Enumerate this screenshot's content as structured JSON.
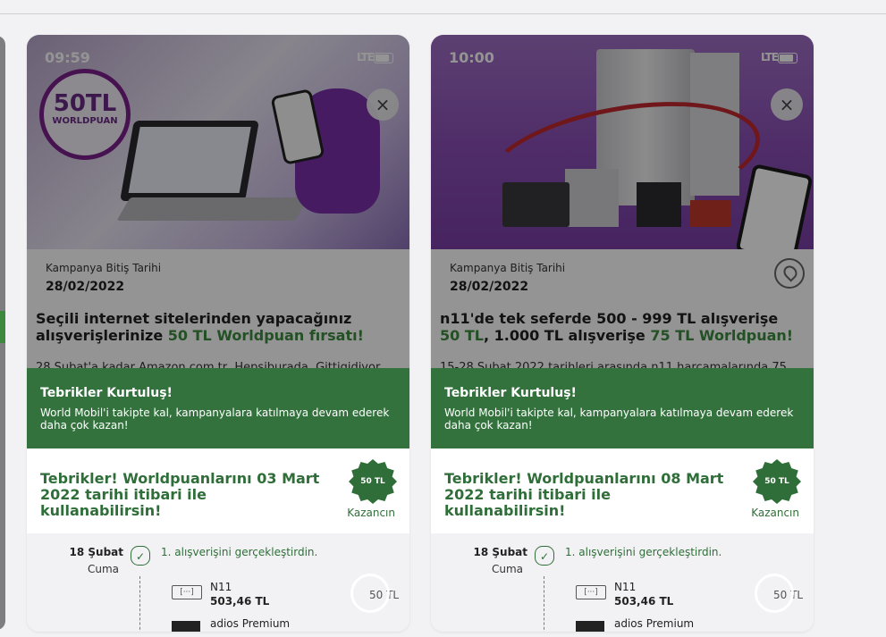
{
  "cards": [
    {
      "status_time": "09:59",
      "status_signal": "LTE",
      "badge_big": "50TL",
      "badge_small": "WORLDPUAN",
      "close_icon": "×",
      "end_label": "Kampanya Bitiş Tarihi",
      "end_date": "28/02/2022",
      "title_plain": "Seçili internet sitelerinden yapacağınız alışverişlerinize ",
      "title_highlight": "50 TL Worldpuan fırsatı!",
      "description": "28 Şubat'a kadar Amazon.com.tr, Hepsiburada, Gittigidiyor...",
      "congrats_title": "Tebrikler Kurtuluş!",
      "congrats_text": "World Mobil'i takipte kal, kampanyalara katılmaya devam ederek daha çok kazan!",
      "reward_text": "Tebrikler! Worldpuanlarını 03 Mart 2022 tarihi itibari ile kullanabilirsin!",
      "reward_badge": "50 TL",
      "reward_status": "Kazancın",
      "tl_day": "18 Şubat",
      "tl_weekday": "Cuma",
      "tl_step": "1. alışverişini gerçekleştirdin.",
      "tl_store": "N11",
      "tl_amount": "503,46 TL",
      "tl_points": "50 TL",
      "tl_store2": "adios Premium"
    },
    {
      "status_time": "10:00",
      "status_signal": "LTE",
      "close_icon": "×",
      "end_label": "Kampanya Bitiş Tarihi",
      "end_date": "28/02/2022",
      "title_plain_1": "n11'de tek seferde 500 - 999 TL alışverişe ",
      "title_highlight_1": "50 TL",
      "title_plain_2": ", 1.000 TL alışverişe ",
      "title_highlight_2": "75 TL Worldpuan!",
      "description": "15-28 Şubat 2022 tarihleri arasında n11 harcamalarında 75...",
      "congrats_title": "Tebrikler Kurtuluş!",
      "congrats_text": "World Mobil'i takipte kal, kampanyalara katılmaya devam ederek daha çok kazan!",
      "reward_text": "Tebrikler! Worldpuanlarını 08 Mart 2022 tarihi itibari ile kullanabilirsin!",
      "reward_badge": "50 TL",
      "reward_status": "Kazancın",
      "tl_day": "18 Şubat",
      "tl_weekday": "Cuma",
      "tl_step": "1. alışverişini gerçekleştirdin.",
      "tl_store": "N11",
      "tl_amount": "503,46 TL",
      "tl_points": "50 TL",
      "tl_store2": "adios Premium"
    }
  ],
  "colors": {
    "brand_green": "#33723d",
    "highlight_green": "#3d8a3f",
    "purple": "#7b1f8a"
  }
}
